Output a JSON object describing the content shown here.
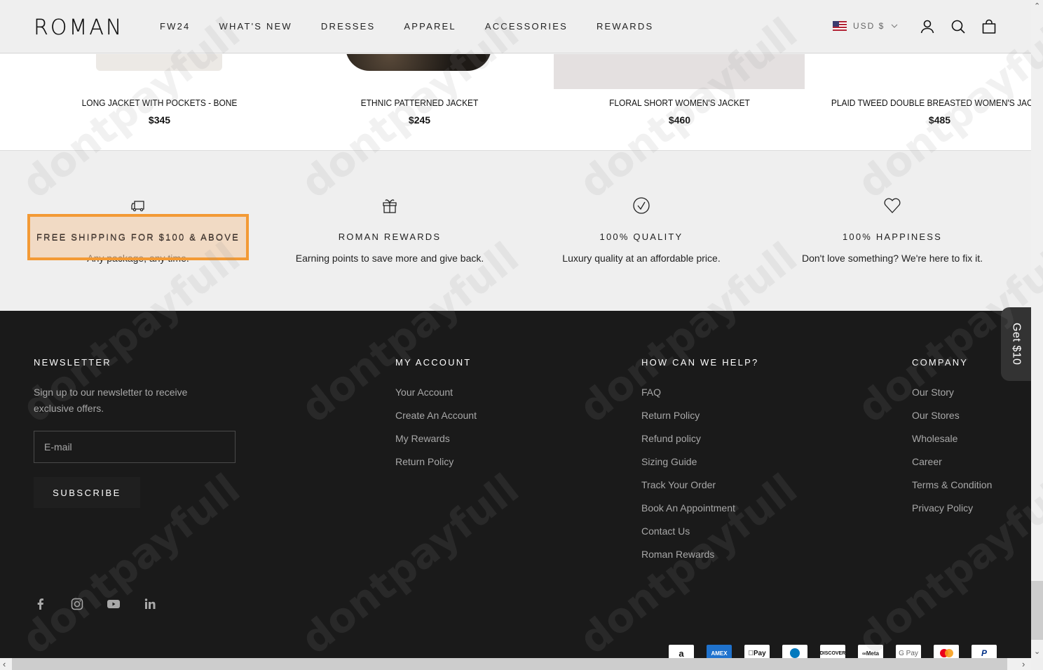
{
  "header": {
    "logo": "ROMAN",
    "nav": [
      "FW24",
      "WHAT'S NEW",
      "DRESSES",
      "APPAREL",
      "ACCESSORIES",
      "REWARDS"
    ],
    "currency": "USD $",
    "icons": [
      "account-icon",
      "search-icon",
      "cart-icon"
    ]
  },
  "products": [
    {
      "title": "LONG JACKET WITH POCKETS - BONE",
      "price": "$345"
    },
    {
      "title": "ETHNIC PATTERNED JACKET",
      "price": "$245"
    },
    {
      "title": "FLORAL SHORT WOMEN'S JACKET",
      "price": "$460"
    },
    {
      "title": "PLAID TWEED DOUBLE BREASTED WOMEN'S JACKET",
      "price": "$485"
    }
  ],
  "features": [
    {
      "icon": "delivery-truck-icon",
      "title": "FREE SHIPPING FOR $100 & ABOVE",
      "desc": "Any package, any time."
    },
    {
      "icon": "gift-icon",
      "title": "ROMAN REWARDS",
      "desc": "Earning points to save more and give back."
    },
    {
      "icon": "check-circle-icon",
      "title": "100% QUALITY",
      "desc": "Luxury quality at an affordable price."
    },
    {
      "icon": "heart-icon",
      "title": "100% HAPPINESS",
      "desc": "Don't love something? We're here to fix it."
    }
  ],
  "highlight": {
    "text": "FREE SHIPPING FOR $100 & ABOVE",
    "color": "#f39a35"
  },
  "footer": {
    "newsletter": {
      "heading": "NEWSLETTER",
      "text": "Sign up to our newsletter to receive exclusive offers.",
      "email_placeholder": "E-mail",
      "email_value": "",
      "subscribe_label": "SUBSCRIBE"
    },
    "my_account": {
      "heading": "MY ACCOUNT",
      "links": [
        "Your Account",
        "Create An Account",
        "My Rewards",
        "Return Policy"
      ]
    },
    "help": {
      "heading": "HOW CAN WE HELP?",
      "links": [
        "FAQ",
        "Return Policy",
        "Refund policy",
        "Sizing Guide",
        "Track Your Order",
        "Book An Appointment",
        "Contact Us",
        "Roman Rewards"
      ]
    },
    "company": {
      "heading": "COMPANY",
      "links": [
        "Our Story",
        "Our Stores",
        "Wholesale",
        "Career",
        "Terms & Condition",
        "Privacy Policy"
      ]
    },
    "social": [
      "facebook-icon",
      "instagram-icon",
      "youtube-icon",
      "linkedin-icon"
    ],
    "payments": [
      "Amazon Pay",
      "American Express",
      "Apple Pay",
      "Diners Club",
      "Discover",
      "Meta Pay",
      "Google Pay",
      "Mastercard",
      "PayPal"
    ]
  },
  "get10_tab": "Get $10",
  "watermark": "dontpayfull"
}
